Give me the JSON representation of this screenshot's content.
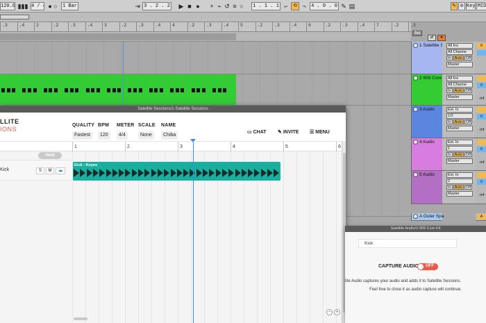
{
  "transport": {
    "tempo": "120.00",
    "signature": "4 / 4",
    "quantize": "1 Bar",
    "position": "3 .   2 .   2",
    "loop_start": "1 .   1 .   1",
    "loop_length": "4 .   0 .   0",
    "key_label": "Key",
    "midi_label": "MID"
  },
  "arrangement": {
    "ruler_ticks": [
      ".3",
      ".4",
      "2",
      ".2",
      ".3",
      ".4",
      "3",
      ".2",
      ".3",
      ".4",
      "4",
      ".2",
      ".3",
      ".4",
      "5",
      ".2",
      ".3",
      ".4",
      "6",
      ".2",
      ".3",
      ".4",
      "7",
      ".2",
      ".3"
    ],
    "set_label": "Set",
    "tracks": [
      {
        "name": "1 Satellite S",
        "input": "All Ins",
        "channel": "All Channe",
        "output": "Master",
        "color": "#a6b6f0",
        "vol": "0"
      },
      {
        "name": "2 909 Core K",
        "input": "All Ins",
        "channel": "All Channe",
        "output": "Master",
        "color": "#33cc33",
        "vol": "0",
        "pan": "-inf"
      },
      {
        "name": "3 Audio",
        "input": "Ext. In",
        "channel": "1/2",
        "output": "Master",
        "color": "#5a86e0",
        "vol": "0",
        "pan": "-inf"
      },
      {
        "name": "4 Audio",
        "input": "Ext. In",
        "channel": "1",
        "output": "Master",
        "color": "#d87ce0",
        "vol": "0",
        "pan": "-inf"
      },
      {
        "name": "5 Audio",
        "input": "Ext. In",
        "channel": "2",
        "output": "Master",
        "color": "#b36fc3",
        "vol": "0",
        "pan": "-inf"
      }
    ],
    "return_track": "A Outer Spa",
    "return_vol": "A",
    "monitor_in": "In",
    "monitor_auto": "Auto",
    "monitor_off": "Off"
  },
  "satellite_sessions": {
    "window_title": "Satellite Sessions/1-Satellite Sessions",
    "logo_line1": "LLITE",
    "logo_line2": "IONS",
    "quality_label": "QUALITY",
    "quality_value": "Fastest",
    "bpm_label": "BPM",
    "bpm_value": "120",
    "meter_label": "METER",
    "meter_value": "4/4",
    "scale_label": "SCALE",
    "scale_value": "None",
    "name_label": "NAME",
    "name_value": "Chiba",
    "chat_label": "CHAT",
    "invite_label": "INVITE",
    "menu_label": "MENU",
    "ruler": [
      "1",
      "2",
      "3",
      "4",
      "5",
      "6"
    ],
    "host_badge": "Host",
    "track_name": "Kick",
    "solo": "S",
    "mute": "M",
    "clip_label": "Kick - Koyes",
    "zoom_out": "−",
    "zoom_in": "+"
  },
  "satellite_audio": {
    "window_title": "Satellite Audio/2-909 Core Kit",
    "track_field": "Kick",
    "capture_label": "CAPTURE AUDIO",
    "capture_state": "OFF",
    "desc_line1": "lite Audio captures your audio and adds it to Satellite Sessions.",
    "desc_line2": "Feel free to close it as audio capture will continue."
  }
}
